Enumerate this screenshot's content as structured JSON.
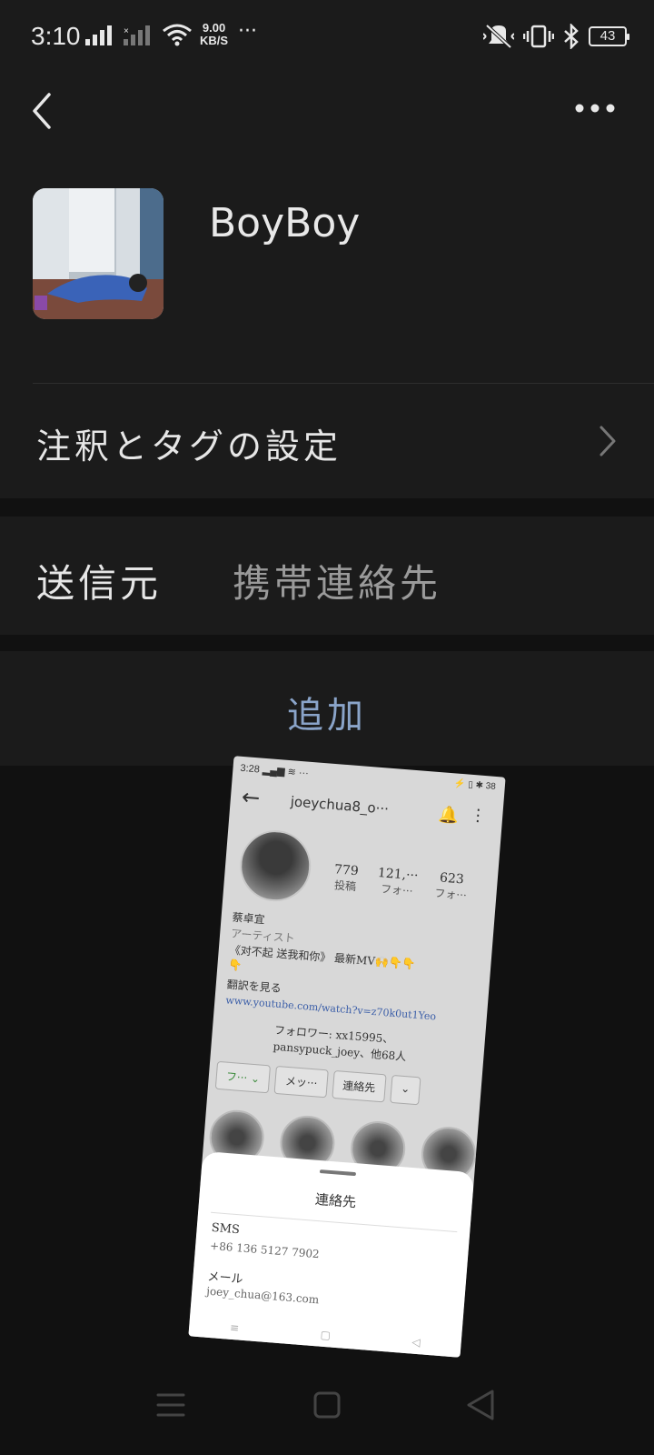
{
  "status_bar": {
    "time": "3:10",
    "speed_value": "9.00",
    "speed_unit": "KB/S",
    "more": "···",
    "battery": "43"
  },
  "header": {
    "name": "BoyBoy",
    "avatar_icon": "avatar-photo"
  },
  "notes_row": {
    "label": "注釈とタグの設定"
  },
  "source_row": {
    "title": "送信元",
    "value": "携帯連絡先"
  },
  "add_row": {
    "label": "追加"
  },
  "embedded_screenshot": {
    "status_time": "3:28",
    "status_more": "···",
    "battery": "38",
    "username": "joeychua8_o···",
    "stats": [
      {
        "value": "779",
        "label": "投稿"
      },
      {
        "value": "121,···",
        "label": "フォ···"
      },
      {
        "value": "623",
        "label": "フォ···"
      }
    ],
    "bio": {
      "name": "蔡卓宜",
      "role": "アーティスト",
      "line1": "《对不起 送我和你》 最新MV🙌👇👇",
      "line2": "👇",
      "translate": "翻訳を見る",
      "link": "www.youtube.com/watch?v=z70k0ut1Yeo",
      "followers": "フォロワー: xx15995、",
      "followers2": "pansypuck_joey、他68人"
    },
    "buttons": [
      "フ··· ⌄",
      "メッ···",
      "連絡先",
      "⌄"
    ],
    "sheet": {
      "title": "連絡先",
      "sms_label": "SMS",
      "sms_value": "+86 136 5127 7902",
      "mail_label": "メール",
      "mail_value": "joey_chua@163.com"
    }
  },
  "colors": {
    "background": "#111111",
    "panel": "#1b1b1b",
    "accent": "#8aa4c9",
    "text_secondary": "#9a9a9a"
  }
}
